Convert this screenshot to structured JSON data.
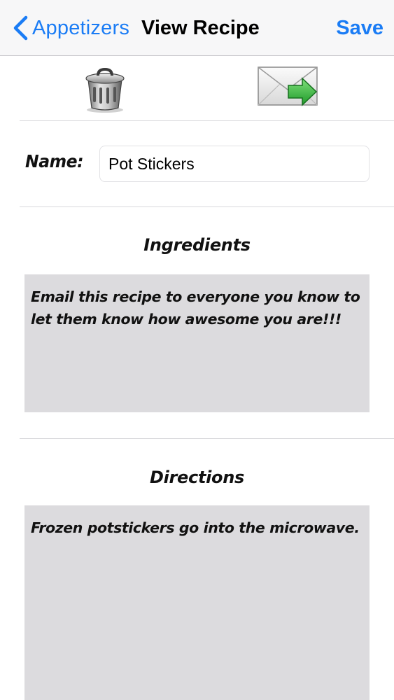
{
  "navbar": {
    "back_label": "Appetizers",
    "title": "View Recipe",
    "save_label": "Save"
  },
  "toolbar": {
    "delete_icon": "trash-can-icon",
    "email_icon": "email-send-icon"
  },
  "form": {
    "name_label": "Name:",
    "name_value": "Pot Stickers"
  },
  "ingredients": {
    "heading": "Ingredients",
    "text": "Email this recipe to everyone you know to let them know how awesome you are!!!"
  },
  "directions": {
    "heading": "Directions",
    "text": "Frozen potstickers go into the microwave."
  },
  "colors": {
    "accent": "#1a7cf5",
    "text_area_bg": "#dcdbde",
    "navbar_bg": "#f7f7f8"
  }
}
